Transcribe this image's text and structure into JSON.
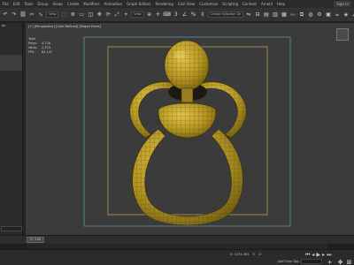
{
  "menubar": {
    "items": [
      "File",
      "Edit",
      "Tools",
      "Group",
      "Views",
      "Create",
      "Modifiers",
      "Animation",
      "Graph Editors",
      "Rendering",
      "Civil View",
      "Customize",
      "Scripting",
      "Content",
      "Arnold",
      "Help"
    ],
    "signin": "Sign In"
  },
  "toolbar": {
    "selection_filter": "Create Selection Se",
    "view_dropdown": "View"
  },
  "left_panel": {
    "items": [
      "ge",
      "",
      "",
      "",
      "",
      "",
      "",
      "",
      "",
      ""
    ],
    "bottom_field": ""
  },
  "viewport": {
    "label": "[+] [Perspective] [User Defined] [Edged Faces]",
    "stats": [
      {
        "k": "Total",
        "v": ""
      },
      {
        "k": "Polys:",
        "v": "4,726"
      },
      {
        "k": "Verts:",
        "v": "2,374"
      },
      {
        "k": "FPS:",
        "v": "85.147"
      }
    ]
  },
  "timeline": {
    "slider_label": "0 / 100"
  },
  "statusbar": {
    "x": "X: 1234.564",
    "y": "Y:",
    "z": "Z:",
    "autokey": "Add Time Tag",
    "grid": "Grid = 10.0"
  },
  "colors": {
    "viewport_bg": "#3b3b3b",
    "mesh_fill": "#b89a2a",
    "mesh_wire": "#3a2c00",
    "safe_frame_outer": "#5a9aa0",
    "safe_frame_inner": "#b8a24a"
  }
}
